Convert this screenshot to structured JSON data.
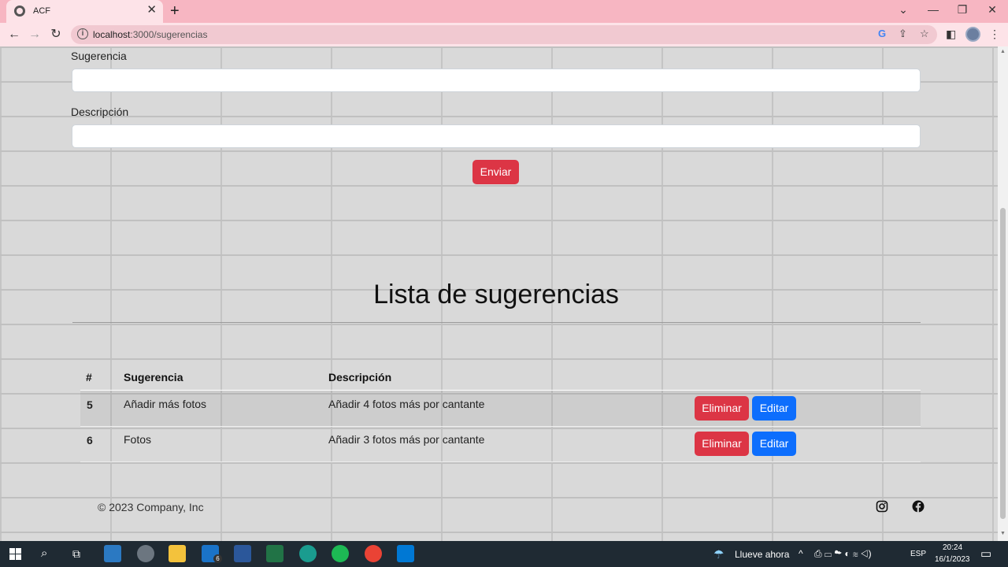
{
  "browser": {
    "tab_title": "ACF",
    "close_tab": "✕",
    "new_tab": "+",
    "url_host": "localhost",
    "url_path": ":3000/sugerencias",
    "window_controls": {
      "chevron": "⌄",
      "minimize": "—",
      "restore": "❐",
      "close": "✕"
    }
  },
  "form": {
    "sugerencia_label": "Sugerencia",
    "sugerencia_value": "",
    "descripcion_label": "Descripción",
    "descripcion_value": "",
    "submit_label": "Enviar"
  },
  "list": {
    "heading": "Lista de sugerencias",
    "columns": [
      "#",
      "Sugerencia",
      "Descripción"
    ],
    "rows": [
      {
        "id": "5",
        "sugerencia": "Añadir más fotos",
        "descripcion": "Añadir 4 fotos más por cantante",
        "delete_label": "Eliminar",
        "edit_label": "Editar"
      },
      {
        "id": "6",
        "sugerencia": "Fotos",
        "descripcion": "Añadir 3 fotos más por cantante",
        "delete_label": "Eliminar",
        "edit_label": "Editar"
      }
    ]
  },
  "footer": {
    "copyright": "© 2023 Company, Inc",
    "social_icons": [
      "instagram-icon",
      "facebook-icon"
    ]
  },
  "taskbar": {
    "weather": "Llueve ahora",
    "language": "ESP",
    "time": "20:24",
    "date": "16/1/2023",
    "mail_badge": "6"
  },
  "colors": {
    "tab_bar": "#f7b6c2",
    "danger": "#dc3545",
    "primary": "#0d6efd"
  }
}
